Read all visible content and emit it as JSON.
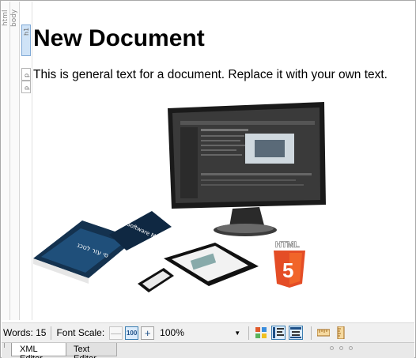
{
  "structure": {
    "gutter_html_label": "html",
    "gutter_body_label": "body",
    "tags": {
      "h1": "h1",
      "p1": "p",
      "p2": "p"
    }
  },
  "document": {
    "title": "New Document",
    "paragraph": "This is general text for a document. Replace it with your own text.",
    "image_badge_text": "HTML",
    "image_badge_number": "5"
  },
  "statusbar": {
    "words_label": "Words: 15",
    "font_scale_label": "Font Scale:",
    "decrease_glyph": "—",
    "reset_glyph": "100",
    "increase_glyph": "+",
    "zoom_value": "100%"
  },
  "tabs": {
    "xml_editor": "XML Editor",
    "text_editor": "Text Editor",
    "active": "XML Editor"
  },
  "colors": {
    "accent": "#3c7fb1",
    "selected_tag": "#cfe3f7",
    "html5_orange": "#e44d26",
    "html5_dark": "#f16529"
  }
}
